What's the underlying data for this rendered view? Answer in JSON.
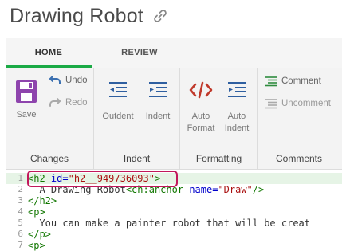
{
  "title": "Drawing Robot",
  "tabs": {
    "home": "HOME",
    "review": "REVIEW"
  },
  "ribbon": {
    "changes": {
      "label": "Changes",
      "save": "Save",
      "undo": "Undo",
      "redo": "Redo"
    },
    "indent": {
      "label": "Indent",
      "outdent": "Outdent",
      "indent": "Indent"
    },
    "formatting": {
      "label": "Formatting",
      "auto_format_1": "Auto",
      "auto_format_2": "Format",
      "auto_indent_1": "Auto",
      "auto_indent_2": "Indent"
    },
    "comments": {
      "label": "Comments",
      "comment": "Comment",
      "uncomment": "Uncomment"
    }
  },
  "editor": {
    "lines": [
      {
        "num": "1",
        "tokens": [
          [
            "tag",
            "<h2 "
          ],
          [
            "attr",
            "id="
          ],
          [
            "str",
            "\"h2__949736093\""
          ],
          [
            "tag",
            ">"
          ]
        ]
      },
      {
        "num": "2",
        "tokens": [
          [
            "text",
            "  A Drawing Robot"
          ],
          [
            "tag",
            "<ch:anchor "
          ],
          [
            "attr",
            "name="
          ],
          [
            "str",
            "\"Draw\""
          ],
          [
            "tag",
            "/>"
          ]
        ]
      },
      {
        "num": "3",
        "tokens": [
          [
            "tag",
            "</h2>"
          ]
        ]
      },
      {
        "num": "4",
        "tokens": [
          [
            "tag",
            "<p>"
          ]
        ]
      },
      {
        "num": "5",
        "tokens": [
          [
            "text",
            "  You can make a painter robot that will be creat"
          ]
        ]
      },
      {
        "num": "6",
        "tokens": [
          [
            "tag",
            "</p>"
          ]
        ]
      },
      {
        "num": "7",
        "tokens": [
          [
            "tag",
            "<p>"
          ]
        ]
      }
    ]
  },
  "colors": {
    "accent": "#1aaa45",
    "save_icon": "#8e44ad",
    "format_icon": "#c0392b",
    "highlight_border": "#c2185b"
  }
}
